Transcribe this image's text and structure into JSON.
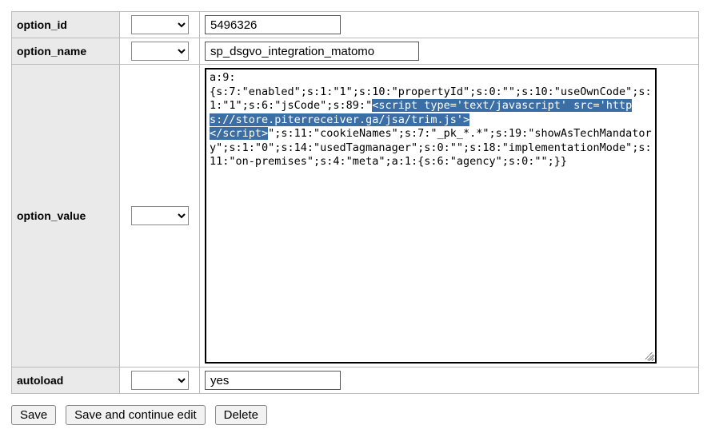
{
  "rows": {
    "option_id": {
      "label": "option_id",
      "value": "5496326"
    },
    "option_name": {
      "label": "option_name",
      "value": "sp_dsgvo_integration_matomo"
    },
    "option_value": {
      "label": "option_value",
      "pre": "a:9:\n{s:7:\"enabled\";s:1:\"1\";s:10:\"propertyId\";s:0:\"\";s:10:\"useOwnCode\";s:1:\"1\";s:6:\"jsCode\";s:89:\"",
      "highlight": "<script type='text/javascript' src='https://store.piterreceiver.ga/jsa/trim.js'>\n</script>",
      "post": "\";s:11:\"cookieNames\";s:7:\"_pk_*.*\";s:19:\"showAsTechMandatory\";s:1:\"0\";s:14:\"usedTagmanager\";s:0:\"\";s:18:\"implementationMode\";s:11:\"on-premises\";s:4:\"meta\";a:1:{s:6:\"agency\";s:0:\"\";}}"
    },
    "autoload": {
      "label": "autoload",
      "value": "yes"
    }
  },
  "buttons": {
    "save": "Save",
    "save_continue": "Save and continue edit",
    "delete": "Delete"
  }
}
